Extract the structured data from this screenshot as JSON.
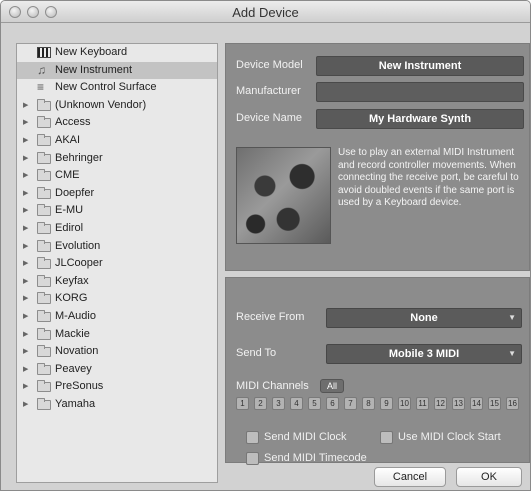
{
  "window": {
    "title": "Add Device"
  },
  "device_list": [
    {
      "label": "New Keyboard",
      "icon": "keyboard-icon",
      "expandable": false,
      "selected": false
    },
    {
      "label": "New Instrument",
      "icon": "instrument-icon",
      "expandable": false,
      "selected": true
    },
    {
      "label": "New Control Surface",
      "icon": "control-surface-icon",
      "expandable": false,
      "selected": false
    },
    {
      "label": "(Unknown Vendor)",
      "icon": "folder-icon",
      "expandable": true,
      "selected": false
    },
    {
      "label": "Access",
      "icon": "folder-icon",
      "expandable": true,
      "selected": false
    },
    {
      "label": "AKAI",
      "icon": "folder-icon",
      "expandable": true,
      "selected": false
    },
    {
      "label": "Behringer",
      "icon": "folder-icon",
      "expandable": true,
      "selected": false
    },
    {
      "label": "CME",
      "icon": "folder-icon",
      "expandable": true,
      "selected": false
    },
    {
      "label": "Doepfer",
      "icon": "folder-icon",
      "expandable": true,
      "selected": false
    },
    {
      "label": "E-MU",
      "icon": "folder-icon",
      "expandable": true,
      "selected": false
    },
    {
      "label": "Edirol",
      "icon": "folder-icon",
      "expandable": true,
      "selected": false
    },
    {
      "label": "Evolution",
      "icon": "folder-icon",
      "expandable": true,
      "selected": false
    },
    {
      "label": "JLCooper",
      "icon": "folder-icon",
      "expandable": true,
      "selected": false
    },
    {
      "label": "Keyfax",
      "icon": "folder-icon",
      "expandable": true,
      "selected": false
    },
    {
      "label": "KORG",
      "icon": "folder-icon",
      "expandable": true,
      "selected": false
    },
    {
      "label": "M-Audio",
      "icon": "folder-icon",
      "expandable": true,
      "selected": false
    },
    {
      "label": "Mackie",
      "icon": "folder-icon",
      "expandable": true,
      "selected": false
    },
    {
      "label": "Novation",
      "icon": "folder-icon",
      "expandable": true,
      "selected": false
    },
    {
      "label": "Peavey",
      "icon": "folder-icon",
      "expandable": true,
      "selected": false
    },
    {
      "label": "PreSonus",
      "icon": "folder-icon",
      "expandable": true,
      "selected": false
    },
    {
      "label": "Yamaha",
      "icon": "folder-icon",
      "expandable": true,
      "selected": false
    }
  ],
  "device": {
    "model_label": "Device Model",
    "model_value": "New Instrument",
    "manufacturer_label": "Manufacturer",
    "manufacturer_value": "",
    "name_label": "Device Name",
    "name_value": "My Hardware Synth",
    "description": "Use to play an external MIDI Instrument and record controller movements. When connecting the receive port, be careful to avoid doubled events if the same port is used by a Keyboard device."
  },
  "ports": {
    "receive_label": "Receive From",
    "receive_value": "None",
    "send_label": "Send To",
    "send_value": "Mobile 3 MIDI"
  },
  "midi_channels": {
    "label": "MIDI Channels",
    "all_label": "All",
    "channels": [
      "1",
      "2",
      "3",
      "4",
      "5",
      "6",
      "7",
      "8",
      "9",
      "10",
      "11",
      "12",
      "13",
      "14",
      "15",
      "16"
    ]
  },
  "options": {
    "send_clock": "Send MIDI Clock",
    "use_clock_start": "Use MIDI Clock Start",
    "send_timecode": "Send MIDI Timecode"
  },
  "buttons": {
    "cancel": "Cancel",
    "ok": "OK"
  }
}
